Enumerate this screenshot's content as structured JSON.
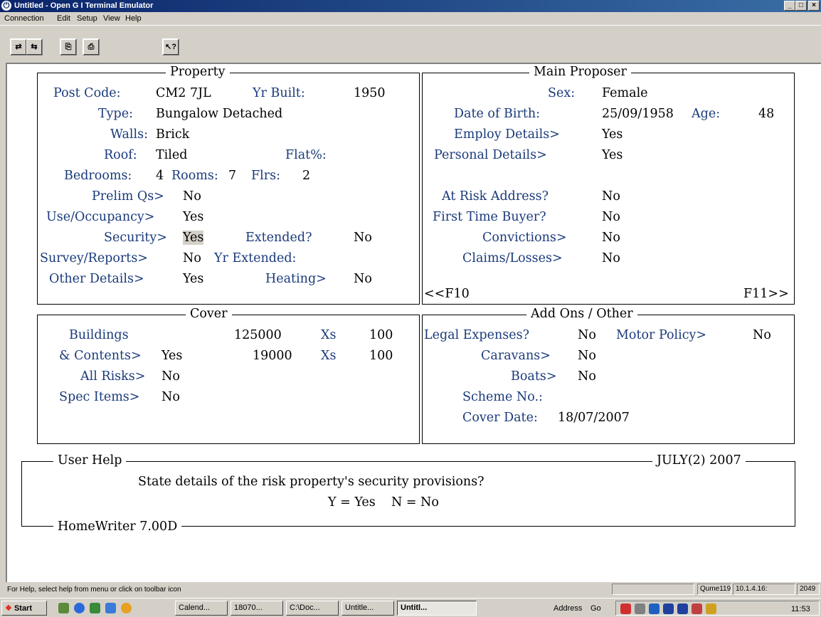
{
  "window": {
    "title": "Untitled - Open G I Terminal Emulator",
    "icon": "power-icon",
    "controls": [
      "_",
      "□",
      "×"
    ]
  },
  "menu": [
    "Connection",
    "Edit",
    "Setup",
    "View",
    "Help"
  ],
  "toolbar": {
    "buttons": [
      "connect-icon",
      "disconnect-icon",
      "copy-icon",
      "print-icon",
      "context-help-icon"
    ]
  },
  "property": {
    "legend": "Property",
    "post_code_label": "Post Code:",
    "post_code": "CM2 7JL",
    "yr_built_label": "Yr Built:",
    "yr_built": "1950",
    "type_label": "Type:",
    "type": "Bungalow Detached",
    "walls_label": "Walls:",
    "walls": "Brick",
    "roof_label": "Roof:",
    "roof": "Tiled",
    "flat_label": "Flat%:",
    "bedrooms_label": "Bedrooms:",
    "bedrooms": "4",
    "rooms_label": "Rooms:",
    "rooms": "7",
    "flrs_label": "Flrs:",
    "flrs": "2",
    "prelim_label": "Prelim Qs>",
    "prelim": "No",
    "use_label": "Use/Occupancy>",
    "use": "Yes",
    "security_label": "Security>",
    "security": "Yes",
    "extended_label": "Extended?",
    "extended": "No",
    "survey_label": "Survey/Reports>",
    "survey": "No",
    "yr_extended_label": "Yr Extended:",
    "other_label": "Other Details>",
    "other": "Yes",
    "heating_label": "Heating>",
    "heating": "No"
  },
  "proposer": {
    "legend": "Main Proposer",
    "sex_label": "Sex:",
    "sex": "Female",
    "dob_label": "Date of Birth:",
    "dob": "25/09/1958",
    "age_label": "Age:",
    "age": "48",
    "employ_label": "Employ Details>",
    "employ": "Yes",
    "personal_label": "Personal Details>",
    "personal": "Yes",
    "risk_addr_label": "At Risk Address?",
    "risk_addr": "No",
    "ftb_label": "First Time Buyer?",
    "ftb": "No",
    "convictions_label": "Convictions>",
    "convictions": "No",
    "claims_label": "Claims/Losses>",
    "claims": "No",
    "prev_key": "<<F10",
    "next_key": "F11>>"
  },
  "cover": {
    "legend": "Cover",
    "buildings_label": "Buildings",
    "buildings_sum": "125000",
    "buildings_xs_label": "Xs",
    "buildings_xs": "100",
    "contents_label": "& Contents>",
    "contents": "Yes",
    "contents_sum": "19000",
    "contents_xs_label": "Xs",
    "contents_xs": "100",
    "allrisks_label": "All Risks>",
    "allrisks": "No",
    "spec_label": "Spec Items>",
    "spec": "No"
  },
  "addons": {
    "legend": "Add Ons / Other",
    "legal_label": "Legal Expenses?",
    "legal": "No",
    "motor_label": "Motor Policy>",
    "motor": "No",
    "caravans_label": "Caravans>",
    "caravans": "No",
    "boats_label": "Boats>",
    "boats": "No",
    "scheme_label": "Scheme No.:",
    "cover_date_label": "Cover Date:",
    "cover_date": "18/07/2007"
  },
  "help": {
    "legend": "User Help",
    "period": "JULY(2) 2007",
    "line1": "State details of the risk property's security provisions?",
    "line2": "Y = Yes    N = No",
    "product": "HomeWriter 7.00D"
  },
  "status": {
    "hint": "For Help, select help from menu or click on toolbar icon",
    "host": "Qume119",
    "ip": "10.1.4.16:",
    "port": "2049"
  },
  "taskbar": {
    "start": "Start",
    "tasks": [
      "Calend...",
      "18070...",
      "C:\\Doc...",
      "Untitle...",
      "Untitl..."
    ],
    "address": "Address",
    "go": "Go",
    "clock": "11:53"
  }
}
